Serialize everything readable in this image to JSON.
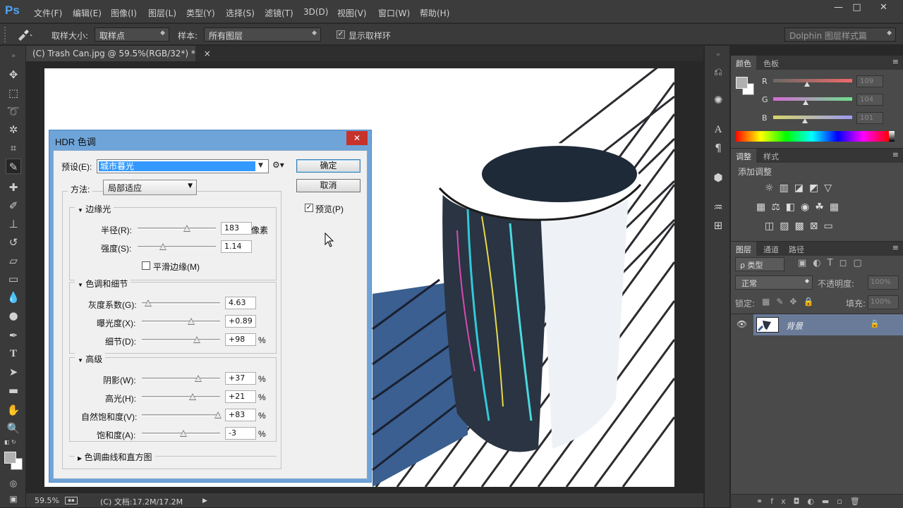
{
  "app": {
    "logo": "Ps"
  },
  "menu": [
    "文件(F)",
    "编辑(E)",
    "图像(I)",
    "图层(L)",
    "类型(Y)",
    "选择(S)",
    "滤镜(T)",
    "3D(D)",
    "视图(V)",
    "窗口(W)",
    "帮助(H)"
  ],
  "window_controls": {
    "minimize": "—",
    "maximize": "□",
    "close": "✕"
  },
  "options": {
    "sample_size_label": "取样大小:",
    "sample_size_value": "取样点",
    "sample_label": "样本:",
    "sample_value": "所有图层",
    "show_ring_label": "显示取样环",
    "show_ring_checked": true,
    "workspace": "Dolphin 图层样式篇"
  },
  "document": {
    "tab_title": "(C) Trash Can.jpg @ 59.5%(RGB/32*) *",
    "tab_close": "×"
  },
  "status": {
    "zoom": "59.5%",
    "doc_info": "(C) 文档:17.2M/17.2M",
    "arrow": "▶"
  },
  "color_panel": {
    "tabs": [
      "颜色",
      "色板"
    ],
    "channels": [
      {
        "name": "R",
        "value": "109",
        "fraction": 0.43
      },
      {
        "name": "G",
        "value": "104",
        "fraction": 0.41
      },
      {
        "name": "B",
        "value": "101",
        "fraction": 0.4
      }
    ]
  },
  "adjust_panel": {
    "tabs": [
      "调整",
      "样式"
    ],
    "subtitle": "添加调整"
  },
  "layers_panel": {
    "tabs": [
      "图层",
      "通道",
      "路径"
    ],
    "filter": "ρ 类型",
    "blend_mode": "正常",
    "opacity_label": "不透明度:",
    "opacity_value": "100%",
    "lock_label": "锁定:",
    "fill_label": "填充:",
    "fill_value": "100%",
    "layer_name": "背景"
  },
  "dialog": {
    "title": "HDR 色调",
    "close": "✕",
    "preset_label": "预设(E):",
    "preset_value": "城市暮光",
    "ok": "确定",
    "cancel": "取消",
    "preview_label": "预览(P)",
    "preview_checked": true,
    "method_label": "方法:",
    "method_value": "局部适应",
    "edge_glow": {
      "title": "边缘光",
      "radius_label": "半径(R):",
      "radius_value": "183",
      "radius_unit": "像素",
      "radius_fraction": 0.59,
      "strength_label": "强度(S):",
      "strength_value": "1.14",
      "strength_fraction": 0.28,
      "smooth_label": "平滑边缘(M)",
      "smooth_checked": false
    },
    "tone_detail": {
      "title": "色调和细节",
      "gamma_label": "灰度系数(G):",
      "gamma_value": "4.63",
      "gamma_fraction": 0.04,
      "exposure_label": "曝光度(X):",
      "exposure_value": "+0.89",
      "exposure_fraction": 0.59,
      "detail_label": "细节(D):",
      "detail_value": "+98",
      "detail_unit": "%",
      "detail_fraction": 0.66
    },
    "advanced": {
      "title": "高级",
      "shadow_label": "阴影(W):",
      "shadow_value": "+37",
      "shadow_fraction": 0.68,
      "highlight_label": "高光(H):",
      "highlight_value": "+21",
      "highlight_fraction": 0.6,
      "vibrance_label": "自然饱和度(V):",
      "vibrance_value": "+83",
      "vibrance_fraction": 0.93,
      "saturation_label": "饱和度(A):",
      "saturation_value": "-3",
      "saturation_fraction": 0.49,
      "unit": "%"
    },
    "curve_section": "色调曲线和直方图"
  }
}
